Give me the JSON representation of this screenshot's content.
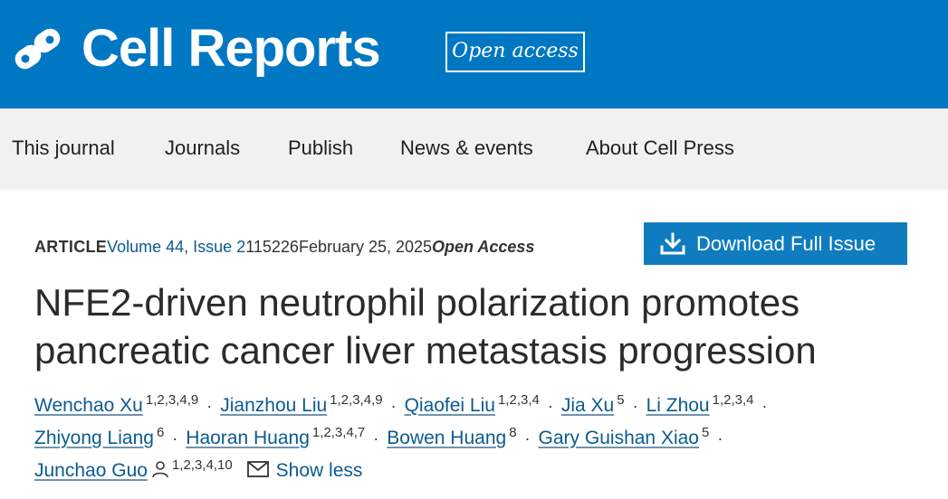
{
  "header": {
    "logo_text": "Cell Reports",
    "badge": "Open access",
    "logo_icon": "cell-press-logo-icon",
    "colors": {
      "brand": "#0077c2",
      "nav_bg": "#f1f1f1",
      "link": "#0c5a8f",
      "button": "#0f7cc0"
    }
  },
  "nav": {
    "items": [
      {
        "label": "This journal"
      },
      {
        "label": "Journals"
      },
      {
        "label": "Publish"
      },
      {
        "label": "News & events"
      },
      {
        "label": "About Cell Press"
      }
    ]
  },
  "article": {
    "type": "ARTICLE",
    "volume_issue": "Volume 44, Issue 2",
    "article_number": "115226",
    "date": "February 25, 2025",
    "access": "Open Access",
    "download_label": "Download Full Issue",
    "download_icon": "download-icon",
    "title": "NFE2-driven neutrophil polarization promotes pancreatic cancer liver metastasis progression"
  },
  "authors": [
    {
      "name": "Wenchao Xu",
      "aff": "1,2,3,4,9"
    },
    {
      "name": "Jianzhou Liu",
      "aff": "1,2,3,4,9"
    },
    {
      "name": "Qiaofei Liu",
      "aff": "1,2,3,4"
    },
    {
      "name": "Jia Xu",
      "aff": "5"
    },
    {
      "name": "Li Zhou",
      "aff": "1,2,3,4"
    },
    {
      "name": "Zhiyong Liang",
      "aff": "6"
    },
    {
      "name": "Haoran Huang",
      "aff": "1,2,3,4,7"
    },
    {
      "name": "Bowen Huang",
      "aff": "8"
    },
    {
      "name": "Gary Guishan Xiao",
      "aff": "5"
    },
    {
      "name": "Junchao Guo",
      "aff": "1,2,3,4,10",
      "corresponding": true
    }
  ],
  "authors_ui": {
    "separator": "·",
    "show_less": "Show less",
    "corresponding_icon": "person-icon",
    "email_icon": "envelope-icon"
  }
}
